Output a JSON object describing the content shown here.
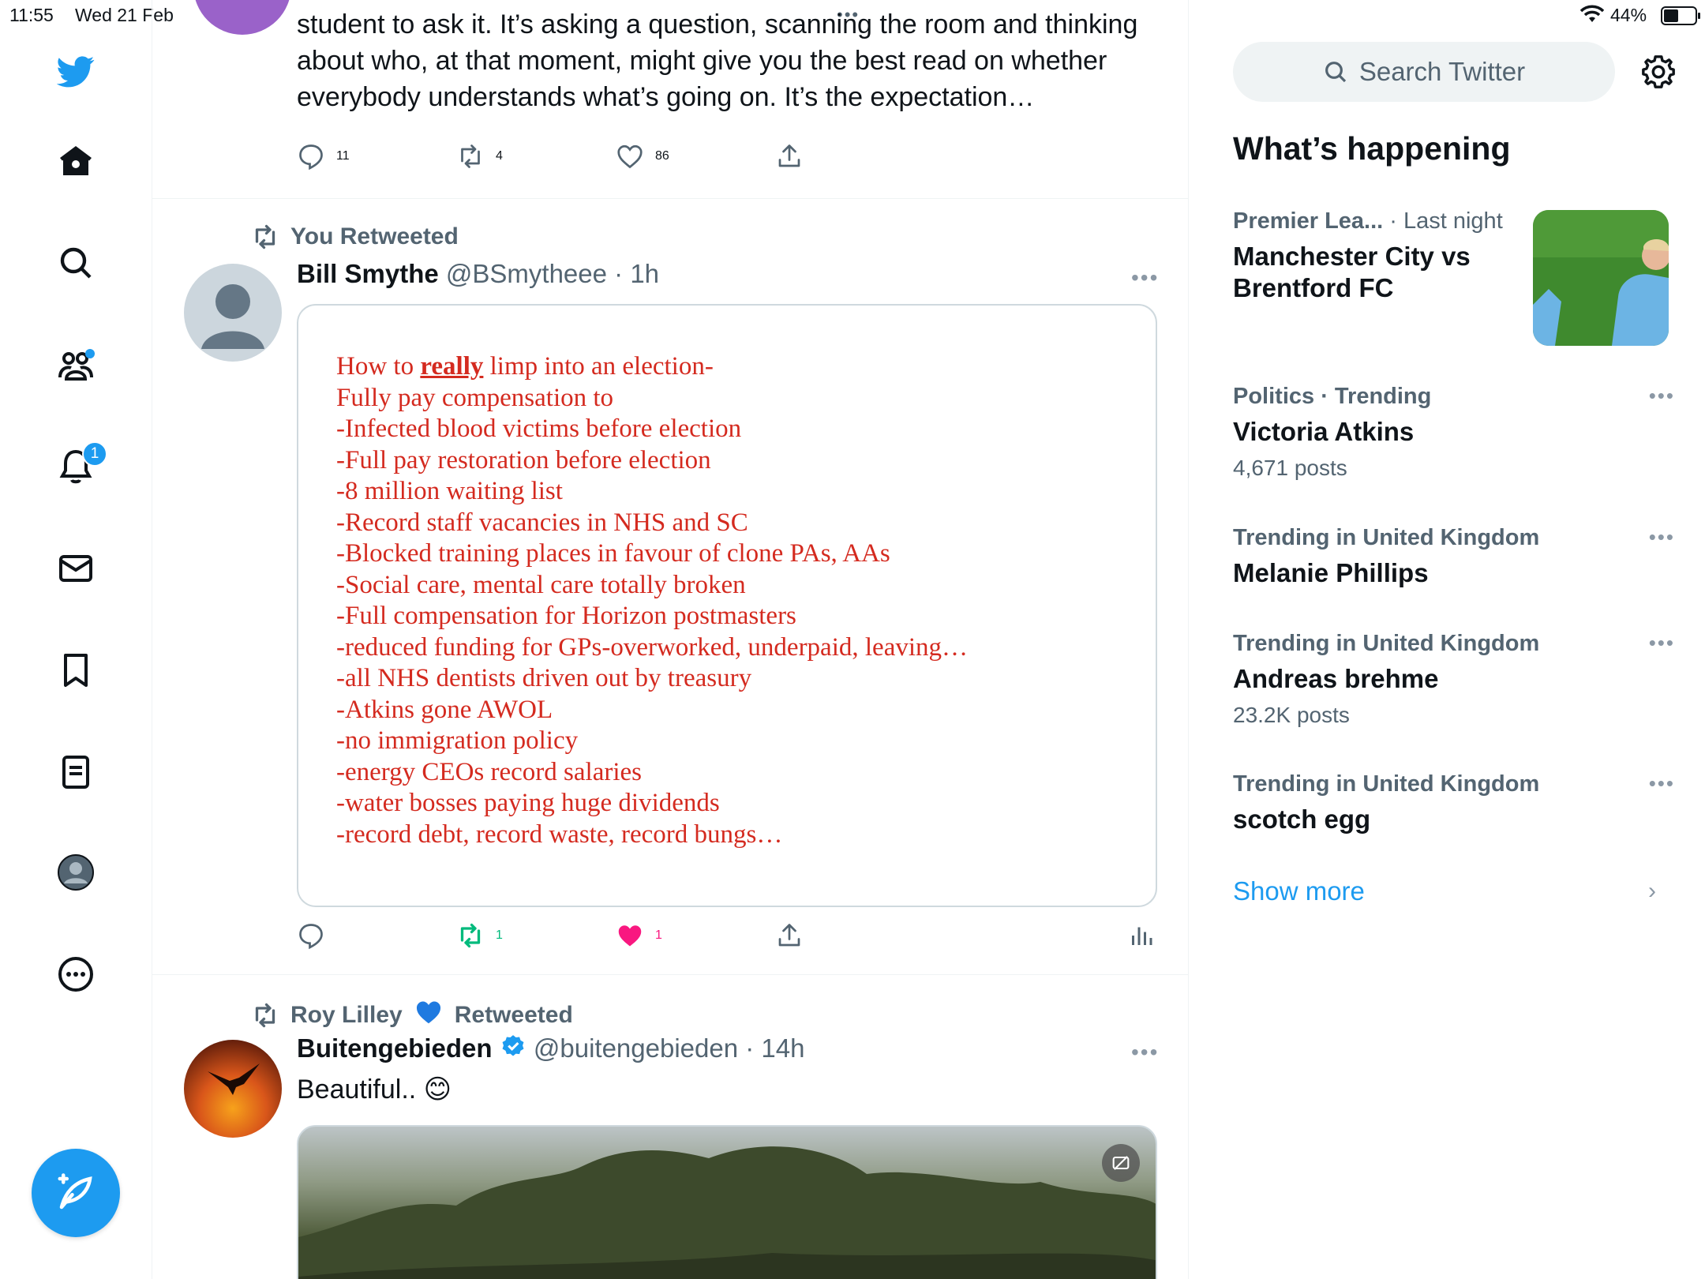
{
  "status_bar": {
    "time": "11:55",
    "date": "Wed 21 Feb",
    "battery": "44%"
  },
  "nav": {
    "notifications_badge": "1"
  },
  "tweet1": {
    "text": "student to ask it. It’s asking a question, scanning the room and thinking about who, at that moment, might give you the best read on whether everybody understands what’s going on. It’s the expectation…",
    "replies": "11",
    "retweets": "4",
    "likes": "86"
  },
  "tweet2": {
    "retweet_label": "You Retweeted",
    "name": "Bill Smythe",
    "handle": "@BSmytheee",
    "time": "1h",
    "image_lines": [
      "Fully pay compensation to",
      "-Infected blood victims before election",
      "-Full pay restoration before election",
      "-8 million waiting list",
      "-Record staff vacancies in NHS and SC",
      "-Blocked training places in favour of clone PAs, AAs",
      "-Social care, mental care totally broken",
      "-Full compensation for Horizon postmasters",
      "-reduced funding for GPs-overworked, underpaid, leaving…",
      "-all NHS dentists driven out by treasury",
      "-Atkins gone AWOL",
      "-no immigration policy",
      "-energy CEOs record salaries",
      "-water bosses paying huge dividends",
      "-record debt, record waste, record bungs…"
    ],
    "image_first_line_pre": "How to ",
    "image_first_line_underlined": "really",
    "image_first_line_post": " limp into an election-",
    "retweets": "1",
    "likes": "1"
  },
  "tweet3": {
    "retweeter": "Roy Lilley",
    "retweet_suffix": "Retweeted",
    "name": "Buitengebieden",
    "handle": "@buitengebieden",
    "time": "14h",
    "text": "Beautiful.. 😊"
  },
  "sidebar": {
    "search_placeholder": "Search Twitter",
    "title": "What’s happening",
    "trends": [
      {
        "context": "Premier Lea...",
        "context_extra": " · Last night",
        "title": "Manchester City vs Brentford FC",
        "count": ""
      },
      {
        "context": "Politics · Trending",
        "context_extra": "",
        "title": "Victoria Atkins",
        "count": "4,671 posts"
      },
      {
        "context": "Trending in United Kingdom",
        "context_extra": "",
        "title": "Melanie Phillips",
        "count": ""
      },
      {
        "context": "Trending in United Kingdom",
        "context_extra": "",
        "title": "Andreas brehme",
        "count": "23.2K posts"
      },
      {
        "context": "Trending in United Kingdom",
        "context_extra": "",
        "title": "scotch egg",
        "count": ""
      }
    ],
    "show_more": "Show more"
  },
  "colors": {
    "accent": "#1d9bf0",
    "like_active": "#f91880",
    "retweet_active": "#00ba7c",
    "doc_red": "#d42a1f"
  }
}
